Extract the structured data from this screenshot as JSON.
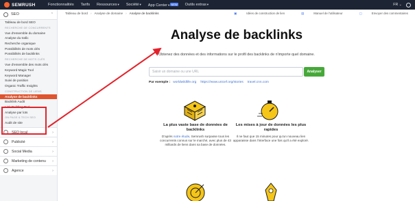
{
  "topbar": {
    "logo": "SEMRUSH",
    "nav": [
      {
        "label": "Fonctionnalités",
        "caret": false,
        "badge": ""
      },
      {
        "label": "Tarifs",
        "caret": false,
        "badge": ""
      },
      {
        "label": "Ressources",
        "caret": true,
        "badge": ""
      },
      {
        "label": "Société",
        "caret": true,
        "badge": ""
      },
      {
        "label": "App Center",
        "caret": true,
        "badge": "NEW"
      },
      {
        "label": "Outils extras",
        "caret": true,
        "badge": ""
      }
    ],
    "lang": "FR ⌄"
  },
  "sidebar": {
    "header": "SEO",
    "dashboard": "Tableau de bord SEO",
    "sections": [
      {
        "title": "RECHERCHE DE CONCURRENTS",
        "items": [
          "Vue d'ensemble du domaine",
          "Analyse du trafic",
          "Recherche organique",
          "Possibilités de mots clés",
          "Possibilités de backlinks"
        ]
      },
      {
        "title": "RECHERCHE DE MOTS CLÉS",
        "items": [
          "Vue d'ensemble des mots clés",
          "Keyword Magic Tool",
          "Keyword Manager",
          "Suivi de position",
          "Organic Traffic Insights"
        ]
      },
      {
        "title": "CONSTRUCTION DE LIENS",
        "items": [
          "Analyse de backlinks",
          "Backlink Audit",
          "Link Building Tool",
          "Analyse par lots"
        ]
      },
      {
        "title": "ON PAGE & TECH SEO",
        "items": [
          "Audit de site"
        ]
      }
    ],
    "groups": [
      "SEO local",
      "Publicité",
      "Social Media",
      "Marketing de contenu",
      "Agence"
    ]
  },
  "main": {
    "breadcrumbs": [
      "Tableau de bord",
      "Analyse de domaine",
      "Analyse de backlinks"
    ],
    "toplinks": [
      "Idées de construction de lien",
      "Manuel de l'utilisateur",
      "Envoyer des commentaires"
    ],
    "title": "Analyse de backlinks",
    "subtitle": "Obtenez des données et des informations sur le profil des backlinks de n'importe quel domaine.",
    "search_placeholder": "Saisir un domaine ou une URL",
    "analyze_button": "Analyser",
    "examples_label": "Par exemple :",
    "examples": [
      "worldwildlife.org",
      "https://www.unicef.org/stories",
      "travel.cnn.com"
    ],
    "features": [
      {
        "title": "La plus vaste base de données de backlinks",
        "text_before": "D'après ",
        "link": "notre étude",
        "text_after": ", Semrush surpasse tous les concurrents connus sur le marché, avec plus de 43 milliards de liens dans sa base de données."
      },
      {
        "title": "Les mises à jour de données les plus rapides",
        "text_before": "Il ne faut que 15 minutes pour qu'un nouveau lien apparaisse dans l'interface une fois qu'il a été exploré.",
        "link": "",
        "text_after": ""
      }
    ]
  },
  "colors": {
    "accent": "#e0542e",
    "button": "#47a83a",
    "illustration": "#f5c518",
    "arrow": "#e3222b"
  }
}
